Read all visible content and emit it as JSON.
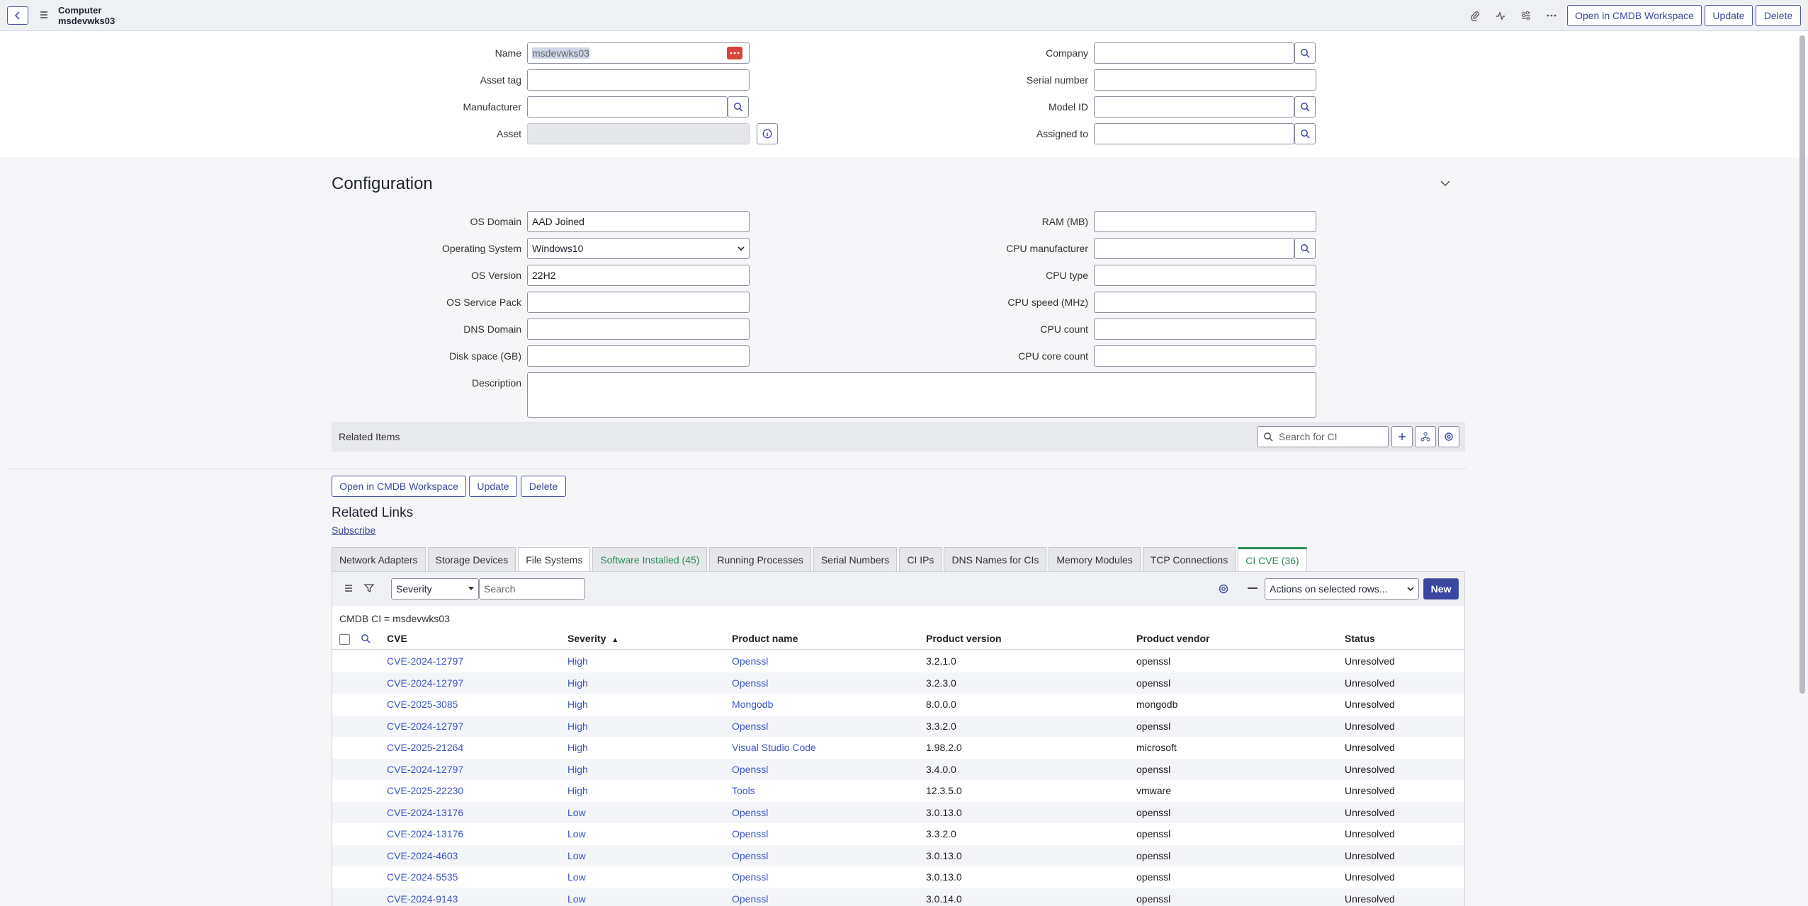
{
  "header": {
    "title_line1": "Computer",
    "title_line2": "msdevwks03",
    "open_cmdb_label": "Open in CMDB Workspace",
    "update_label": "Update",
    "delete_label": "Delete"
  },
  "form": {
    "name_label": "Name",
    "name_value": "msdevwks03",
    "asset_tag_label": "Asset tag",
    "asset_tag_value": "",
    "manufacturer_label": "Manufacturer",
    "manufacturer_value": "",
    "asset_label": "Asset",
    "asset_value": "",
    "company_label": "Company",
    "company_value": "",
    "serial_label": "Serial number",
    "serial_value": "",
    "model_label": "Model ID",
    "model_value": "",
    "assigned_label": "Assigned to",
    "assigned_value": ""
  },
  "config": {
    "title": "Configuration",
    "os_domain_label": "OS Domain",
    "os_domain_value": "AAD Joined",
    "os_label": "Operating System",
    "os_value": "Windows10",
    "os_version_label": "OS Version",
    "os_version_value": "22H2",
    "os_sp_label": "OS Service Pack",
    "os_sp_value": "",
    "dns_label": "DNS Domain",
    "dns_value": "",
    "disk_label": "Disk space (GB)",
    "disk_value": "",
    "desc_label": "Description",
    "desc_value": "",
    "ram_label": "RAM (MB)",
    "ram_value": "",
    "cpu_mfr_label": "CPU manufacturer",
    "cpu_mfr_value": "",
    "cpu_type_label": "CPU type",
    "cpu_type_value": "",
    "cpu_speed_label": "CPU speed (MHz)",
    "cpu_speed_value": "",
    "cpu_count_label": "CPU count",
    "cpu_count_value": "",
    "cpu_core_label": "CPU core count",
    "cpu_core_value": ""
  },
  "related": {
    "items_label": "Related Items",
    "search_placeholder": "Search for CI"
  },
  "bottom_buttons": {
    "open_cmdb": "Open in CMDB Workspace",
    "update": "Update",
    "delete": "Delete"
  },
  "related_links": {
    "title": "Related Links",
    "subscribe": "Subscribe"
  },
  "tabs": [
    {
      "label": "Network Adapters"
    },
    {
      "label": "Storage Devices"
    },
    {
      "label": "File Systems"
    },
    {
      "label": "Software Installed (45)"
    },
    {
      "label": "Running Processes"
    },
    {
      "label": "Serial Numbers"
    },
    {
      "label": "CI IPs"
    },
    {
      "label": "DNS Names for CIs"
    },
    {
      "label": "Memory Modules"
    },
    {
      "label": "TCP Connections"
    },
    {
      "label": "CI CVE (36)"
    }
  ],
  "list": {
    "filter_field": "Severity",
    "search_placeholder": "Search",
    "actions_label": "Actions on selected rows...",
    "new_label": "New",
    "breadcrumb": "CMDB CI = msdevwks03",
    "columns": [
      "CVE",
      "Severity",
      "Product name",
      "Product version",
      "Product vendor",
      "Status"
    ],
    "sort_indicator": "▲",
    "rows": [
      {
        "cve": "CVE-2024-12797",
        "severity": "High",
        "product": "Openssl",
        "version": "3.2.1.0",
        "vendor": "openssl",
        "status": "Unresolved"
      },
      {
        "cve": "CVE-2024-12797",
        "severity": "High",
        "product": "Openssl",
        "version": "3.2.3.0",
        "vendor": "openssl",
        "status": "Unresolved"
      },
      {
        "cve": "CVE-2025-3085",
        "severity": "High",
        "product": "Mongodb",
        "version": "8.0.0.0",
        "vendor": "mongodb",
        "status": "Unresolved"
      },
      {
        "cve": "CVE-2024-12797",
        "severity": "High",
        "product": "Openssl",
        "version": "3.3.2.0",
        "vendor": "openssl",
        "status": "Unresolved"
      },
      {
        "cve": "CVE-2025-21264",
        "severity": "High",
        "product": "Visual Studio Code",
        "version": "1.98.2.0",
        "vendor": "microsoft",
        "status": "Unresolved"
      },
      {
        "cve": "CVE-2024-12797",
        "severity": "High",
        "product": "Openssl",
        "version": "3.4.0.0",
        "vendor": "openssl",
        "status": "Unresolved"
      },
      {
        "cve": "CVE-2025-22230",
        "severity": "High",
        "product": "Tools",
        "version": "12.3.5.0",
        "vendor": "vmware",
        "status": "Unresolved"
      },
      {
        "cve": "CVE-2024-13176",
        "severity": "Low",
        "product": "Openssl",
        "version": "3.0.13.0",
        "vendor": "openssl",
        "status": "Unresolved"
      },
      {
        "cve": "CVE-2024-13176",
        "severity": "Low",
        "product": "Openssl",
        "version": "3.3.2.0",
        "vendor": "openssl",
        "status": "Unresolved"
      },
      {
        "cve": "CVE-2024-4603",
        "severity": "Low",
        "product": "Openssl",
        "version": "3.0.13.0",
        "vendor": "openssl",
        "status": "Unresolved"
      },
      {
        "cve": "CVE-2024-5535",
        "severity": "Low",
        "product": "Openssl",
        "version": "3.0.13.0",
        "vendor": "openssl",
        "status": "Unresolved"
      },
      {
        "cve": "CVE-2024-9143",
        "severity": "Low",
        "product": "Openssl",
        "version": "3.0.14.0",
        "vendor": "openssl",
        "status": "Unresolved"
      }
    ]
  },
  "icons": {
    "back": "chevron-left-icon",
    "menu": "hamburger-icon",
    "attach": "paperclip-icon",
    "activity": "activity-icon",
    "settings": "sliders-icon",
    "more": "ellipsis-icon"
  },
  "colors": {
    "accent": "#3a47a0",
    "link": "#3a56c4",
    "active_tab": "#2e8b57",
    "name_badge": "#d9453a"
  }
}
